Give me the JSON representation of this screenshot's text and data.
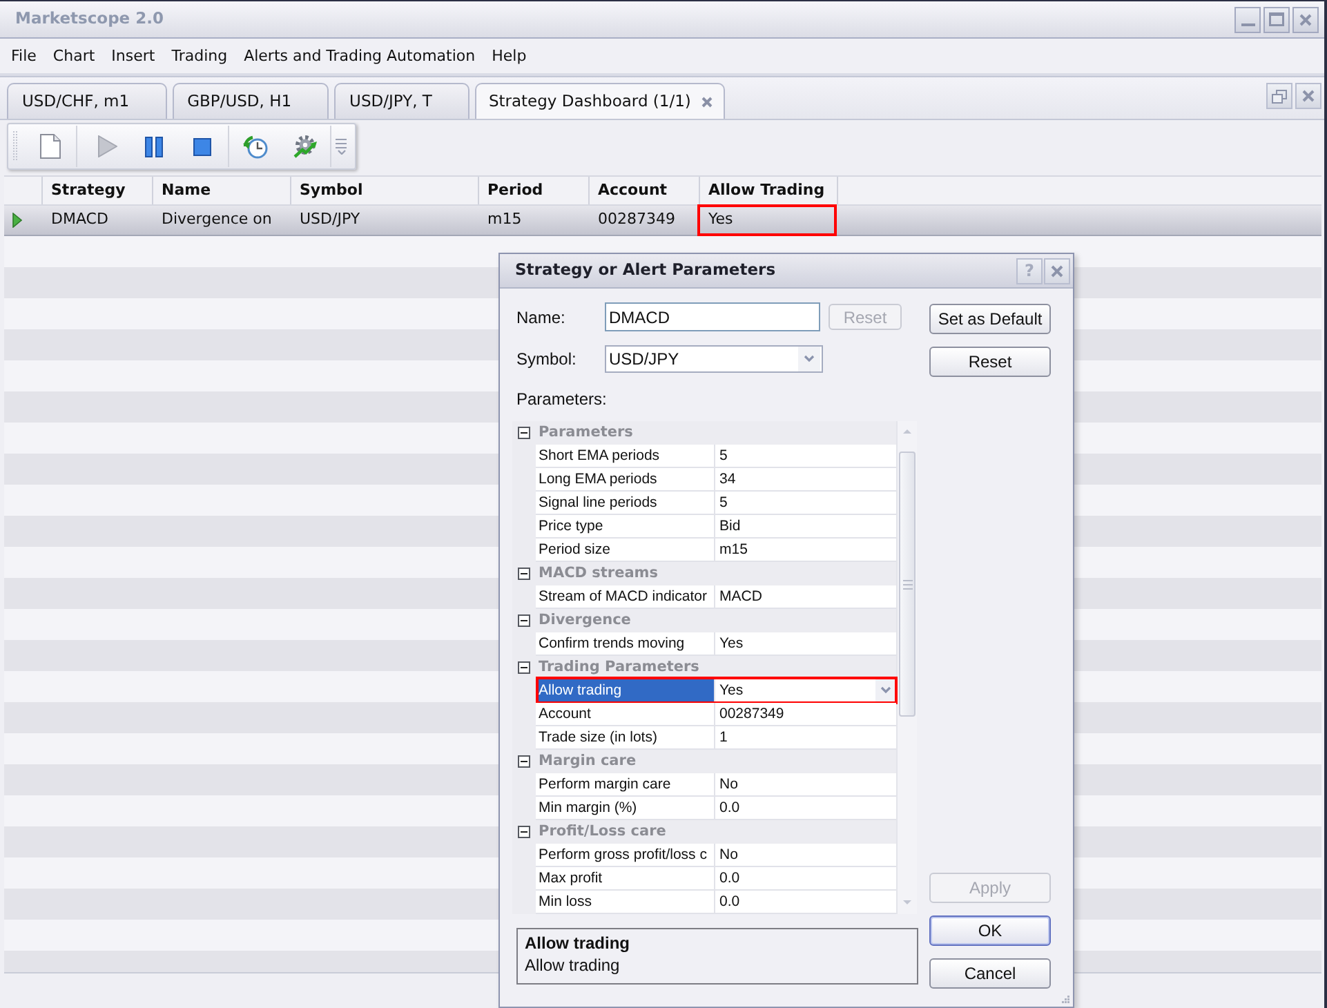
{
  "window": {
    "title": "Marketscope 2.0"
  },
  "menu": [
    "File",
    "Chart",
    "Insert",
    "Trading",
    "Alerts and Trading Automation",
    "Help"
  ],
  "tabs": [
    {
      "label": "USD/CHF, m1",
      "selected": false
    },
    {
      "label": "GBP/USD, H1",
      "selected": false
    },
    {
      "label": "USD/JPY, T",
      "selected": false
    },
    {
      "label": "Strategy Dashboard (1/1)",
      "selected": true
    }
  ],
  "toolbar": [
    {
      "kind": "new",
      "disabled": false
    },
    {
      "kind": "start",
      "disabled": true
    },
    {
      "kind": "pause",
      "disabled": false
    },
    {
      "kind": "stop",
      "disabled": false
    },
    {
      "kind": "schedule",
      "disabled": false
    },
    {
      "kind": "settings",
      "disabled": false
    }
  ],
  "table": {
    "columns": [
      "Strategy",
      "Name",
      "Symbol",
      "Period",
      "Account",
      "Allow Trading"
    ],
    "rows": [
      {
        "selected": true,
        "running": true,
        "cells": [
          {
            "text": "DMACD",
            "highlighted": false
          },
          {
            "text": "Divergence on",
            "highlighted": false
          },
          {
            "text": "USD/JPY",
            "highlighted": false
          },
          {
            "text": "m15",
            "highlighted": false
          },
          {
            "text": "00287349",
            "highlighted": false
          },
          {
            "text": "Yes",
            "highlighted": true
          }
        ]
      }
    ]
  },
  "dialog": {
    "title": "Strategy or Alert Parameters",
    "help_button": "?",
    "name_label": "Name:",
    "name_value": "DMACD",
    "name_reset": {
      "label": "Reset",
      "disabled": true
    },
    "symbol_label": "Symbol:",
    "symbol_value": "USD/JPY",
    "parameters_label": "Parameters:",
    "parameter_groups": [
      {
        "title": "Parameters",
        "expanded": true,
        "rows": [
          {
            "name": "Short EMA periods",
            "value": "5",
            "selected": false,
            "highlighted": false
          },
          {
            "name": "Long EMA periods",
            "value": "34",
            "selected": false,
            "highlighted": false
          },
          {
            "name": "Signal line periods",
            "value": "5",
            "selected": false,
            "highlighted": false
          },
          {
            "name": "Price type",
            "value": "Bid",
            "selected": false,
            "highlighted": false
          },
          {
            "name": "Period size",
            "value": "m15",
            "selected": false,
            "highlighted": false
          }
        ]
      },
      {
        "title": "MACD streams",
        "expanded": true,
        "rows": [
          {
            "name": "Stream of MACD indicator",
            "value": "MACD",
            "selected": false,
            "highlighted": false
          }
        ]
      },
      {
        "title": "Divergence",
        "expanded": true,
        "rows": [
          {
            "name": "Confirm trends moving",
            "value": "Yes",
            "selected": false,
            "highlighted": false
          }
        ]
      },
      {
        "title": "Trading Parameters",
        "expanded": true,
        "rows": [
          {
            "name": "Allow trading",
            "value": "Yes",
            "selected": true,
            "highlighted": true
          },
          {
            "name": "Account",
            "value": "00287349",
            "selected": false,
            "highlighted": false
          },
          {
            "name": "Trade size (in lots)",
            "value": "1",
            "selected": false,
            "highlighted": false
          }
        ]
      },
      {
        "title": "Margin care",
        "expanded": true,
        "rows": [
          {
            "name": "Perform margin care",
            "value": "No",
            "selected": false,
            "highlighted": false
          },
          {
            "name": "Min margin (%)",
            "value": "0.0",
            "selected": false,
            "highlighted": false
          }
        ]
      },
      {
        "title": "Profit/Loss care",
        "expanded": true,
        "rows": [
          {
            "name": "Perform gross profit/loss c",
            "value": "No",
            "selected": false,
            "highlighted": false
          },
          {
            "name": "Max profit",
            "value": "0.0",
            "selected": false,
            "highlighted": false
          },
          {
            "name": "Min loss",
            "value": "0.0",
            "selected": false,
            "highlighted": false
          }
        ]
      }
    ],
    "description": {
      "title": "Allow trading",
      "text": "Allow trading"
    },
    "side_buttons": [
      {
        "label": "Set as Default",
        "disabled": false
      },
      {
        "label": "Reset",
        "disabled": false
      }
    ],
    "action_buttons": [
      {
        "label": "Apply",
        "disabled": true,
        "focused": false
      },
      {
        "label": "OK",
        "disabled": false,
        "focused": true
      },
      {
        "label": "Cancel",
        "disabled": false,
        "focused": false
      }
    ]
  }
}
